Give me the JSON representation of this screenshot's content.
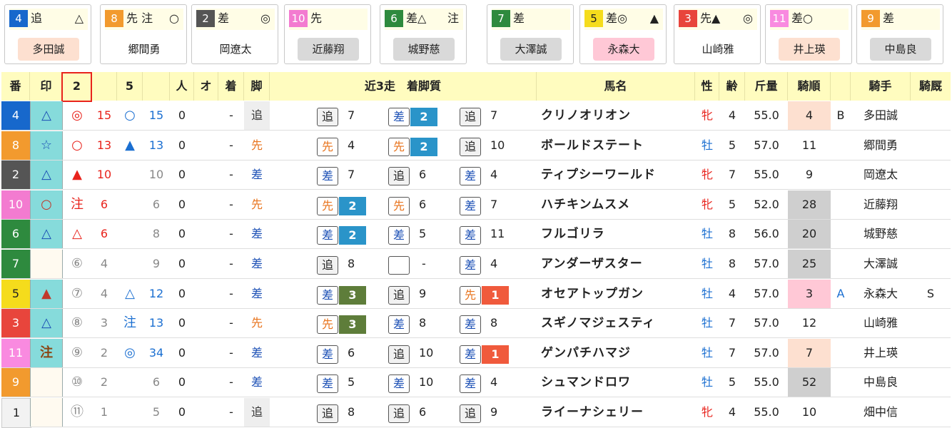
{
  "cards": [
    {
      "num": "4",
      "num_color": "#1768cc",
      "text": "追",
      "mark": "△",
      "name": "多田誠",
      "name_bg": "#fde0d0"
    },
    {
      "num": "8",
      "num_color": "#f29a2e",
      "text": "先 注",
      "mark": "○",
      "name": "郷間勇",
      "name_bg": "#ffffff"
    },
    {
      "num": "2",
      "num_color": "#555555",
      "text": "差",
      "mark": "◎",
      "name": "岡遼太",
      "name_bg": "#ffffff"
    },
    {
      "num": "10",
      "num_color": "#f37bd0",
      "text": "先",
      "mark": "",
      "name": "近藤翔",
      "name_bg": "#d9d9d9"
    },
    {
      "num": "6",
      "num_color": "#2e8a3e",
      "text": "差△",
      "mark": "注",
      "name": "城野慈",
      "name_bg": "#d9d9d9"
    },
    {
      "num": "7",
      "num_color": "#2e8a3e",
      "text": "差",
      "mark": "",
      "name": "大澤誠",
      "name_bg": "#d9d9d9"
    },
    {
      "num": "5",
      "num_color": "#f5dc1c",
      "text": "差◎",
      "mark": "▲",
      "name": "永森大",
      "name_bg": "#ffc8d6"
    },
    {
      "num": "3",
      "num_color": "#e8453c",
      "text": "先▲",
      "mark": "◎",
      "name": "山崎雅",
      "name_bg": "#ffffff"
    },
    {
      "num": "11",
      "num_color": "#f98ae0",
      "text": "差○",
      "mark": "",
      "name": "井上瑛",
      "name_bg": "#fde0d0"
    },
    {
      "num": "9",
      "num_color": "#f29a2e",
      "text": "差",
      "mark": "",
      "name": "中島良",
      "name_bg": "#d9d9d9"
    }
  ],
  "headers": {
    "ban": "番",
    "shirushi": "印",
    "c2": "2",
    "c5": "5",
    "nin": "人",
    "o": "オ",
    "chaku": "着",
    "ashi": "脚",
    "recent": "近3走　着脚質",
    "horse": "馬名",
    "sex": "性",
    "age": "齢",
    "weight": "斤量",
    "jrank": "騎順",
    "jockey": "騎手",
    "kyusha": "騎厩"
  },
  "rows": [
    {
      "num": "4",
      "num_color": "#1768cc",
      "mark": "△",
      "m2": "◎",
      "m2v": "15",
      "m5": "○",
      "m5v": "15",
      "nin": "0",
      "chaku": "-",
      "ashi": "追",
      "p": [
        {
          "k": "追",
          "v": "7"
        },
        {
          "k": "差",
          "v": "2"
        },
        {
          "k": "追",
          "v": "7"
        }
      ],
      "horse": "クリノオリオン",
      "sex": "牝",
      "age": "4",
      "weight": "55.0",
      "jrank": "4",
      "jbg": "peach",
      "grade": "B",
      "jockey": "多田誠",
      "kyusha": ""
    },
    {
      "num": "8",
      "num_color": "#f29a2e",
      "mark": "☆",
      "m2": "○",
      "m2v": "13",
      "m5": "▲",
      "m5v": "13",
      "nin": "0",
      "chaku": "-",
      "ashi": "先",
      "p": [
        {
          "k": "先",
          "v": "4"
        },
        {
          "k": "先",
          "v": "2"
        },
        {
          "k": "追",
          "v": "10"
        }
      ],
      "horse": "ボールドステート",
      "sex": "牡",
      "age": "5",
      "weight": "57.0",
      "jrank": "11",
      "jbg": "",
      "grade": "",
      "jockey": "郷間勇",
      "kyusha": ""
    },
    {
      "num": "2",
      "num_color": "#555555",
      "mark": "△",
      "m2": "▲",
      "m2v": "10",
      "m5": "",
      "m5v": "10",
      "nin": "0",
      "chaku": "-",
      "ashi": "差",
      "p": [
        {
          "k": "差",
          "v": "7"
        },
        {
          "k": "追",
          "v": "6"
        },
        {
          "k": "差",
          "v": "4"
        }
      ],
      "horse": "ティプシーワールド",
      "sex": "牝",
      "age": "7",
      "weight": "55.0",
      "jrank": "9",
      "jbg": "",
      "grade": "",
      "jockey": "岡遼太",
      "kyusha": ""
    },
    {
      "num": "10",
      "num_color": "#f37bd0",
      "mark": "○",
      "m2": "注",
      "m2v": "6",
      "m5": "",
      "m5v": "6",
      "nin": "0",
      "chaku": "-",
      "ashi": "先",
      "p": [
        {
          "k": "先",
          "v": "2"
        },
        {
          "k": "先",
          "v": "6"
        },
        {
          "k": "差",
          "v": "7"
        }
      ],
      "horse": "ハチキンムスメ",
      "sex": "牝",
      "age": "5",
      "weight": "52.0",
      "jrank": "28",
      "jbg": "gray",
      "grade": "",
      "jockey": "近藤翔",
      "kyusha": ""
    },
    {
      "num": "6",
      "num_color": "#2e8a3e",
      "mark": "△",
      "m2": "△",
      "m2v": "6",
      "m5": "",
      "m5v": "8",
      "nin": "0",
      "chaku": "-",
      "ashi": "差",
      "p": [
        {
          "k": "差",
          "v": "2"
        },
        {
          "k": "差",
          "v": "5"
        },
        {
          "k": "差",
          "v": "11"
        }
      ],
      "horse": "フルゴリラ",
      "sex": "牡",
      "age": "8",
      "weight": "56.0",
      "jrank": "20",
      "jbg": "gray",
      "grade": "",
      "jockey": "城野慈",
      "kyusha": ""
    },
    {
      "num": "7",
      "num_color": "#2e8a3e",
      "mark": "",
      "m2": "⑥",
      "m2v": "4",
      "m5": "",
      "m5v": "9",
      "nin": "0",
      "chaku": "-",
      "ashi": "差",
      "p": [
        {
          "k": "追",
          "v": "8"
        },
        {
          "k": "",
          "v": "-"
        },
        {
          "k": "差",
          "v": "4"
        }
      ],
      "horse": "アンダーザスター",
      "sex": "牡",
      "age": "8",
      "weight": "57.0",
      "jrank": "25",
      "jbg": "gray",
      "grade": "",
      "jockey": "大澤誠",
      "kyusha": ""
    },
    {
      "num": "5",
      "num_color": "#f5dc1c",
      "mark": "▲",
      "m2": "⑦",
      "m2v": "4",
      "m5": "△",
      "m5v": "12",
      "nin": "0",
      "chaku": "-",
      "ashi": "差",
      "p": [
        {
          "k": "差",
          "v": "3"
        },
        {
          "k": "追",
          "v": "9"
        },
        {
          "k": "先",
          "v": "1"
        }
      ],
      "horse": "オセアトップガン",
      "sex": "牡",
      "age": "4",
      "weight": "57.0",
      "jrank": "3",
      "jbg": "pink",
      "grade": "A",
      "jockey": "永森大",
      "kyusha": "S"
    },
    {
      "num": "3",
      "num_color": "#e8453c",
      "mark": "△",
      "m2": "⑧",
      "m2v": "3",
      "m5": "注",
      "m5v": "13",
      "nin": "0",
      "chaku": "-",
      "ashi": "先",
      "p": [
        {
          "k": "先",
          "v": "3"
        },
        {
          "k": "差",
          "v": "8"
        },
        {
          "k": "差",
          "v": "8"
        }
      ],
      "horse": "スギノマジェスティ",
      "sex": "牡",
      "age": "7",
      "weight": "57.0",
      "jrank": "12",
      "jbg": "",
      "grade": "",
      "jockey": "山崎雅",
      "kyusha": ""
    },
    {
      "num": "11",
      "num_color": "#f98ae0",
      "mark": "注",
      "m2": "⑨",
      "m2v": "2",
      "m5": "◎",
      "m5v": "34",
      "nin": "0",
      "chaku": "-",
      "ashi": "差",
      "p": [
        {
          "k": "差",
          "v": "6"
        },
        {
          "k": "追",
          "v": "10"
        },
        {
          "k": "差",
          "v": "1"
        }
      ],
      "horse": "ゲンパチハマジ",
      "sex": "牡",
      "age": "7",
      "weight": "57.0",
      "jrank": "7",
      "jbg": "peach",
      "grade": "",
      "jockey": "井上瑛",
      "kyusha": ""
    },
    {
      "num": "9",
      "num_color": "#f29a2e",
      "mark": "",
      "m2": "⑩",
      "m2v": "2",
      "m5": "",
      "m5v": "6",
      "nin": "0",
      "chaku": "-",
      "ashi": "差",
      "p": [
        {
          "k": "差",
          "v": "5"
        },
        {
          "k": "差",
          "v": "10"
        },
        {
          "k": "差",
          "v": "4"
        }
      ],
      "horse": "シュマンドロワ",
      "sex": "牡",
      "age": "5",
      "weight": "55.0",
      "jrank": "52",
      "jbg": "gray",
      "grade": "",
      "jockey": "中島良",
      "kyusha": ""
    },
    {
      "num": "1",
      "num_color": "#f2f2f2",
      "mark": "",
      "m2": "⑪",
      "m2v": "1",
      "m5": "",
      "m5v": "5",
      "nin": "0",
      "chaku": "-",
      "ashi": "追",
      "p": [
        {
          "k": "追",
          "v": "8"
        },
        {
          "k": "追",
          "v": "6"
        },
        {
          "k": "追",
          "v": "9"
        }
      ],
      "horse": "ライーナシェリー",
      "sex": "牝",
      "age": "4",
      "weight": "55.0",
      "jrank": "10",
      "jbg": "",
      "grade": "",
      "jockey": "畑中信",
      "kyusha": ""
    }
  ],
  "badge_colors": {
    "1": "#f05a3c",
    "2": "#2a94c9",
    "3": "#5e7d3a"
  },
  "selected_header_note": "2"
}
